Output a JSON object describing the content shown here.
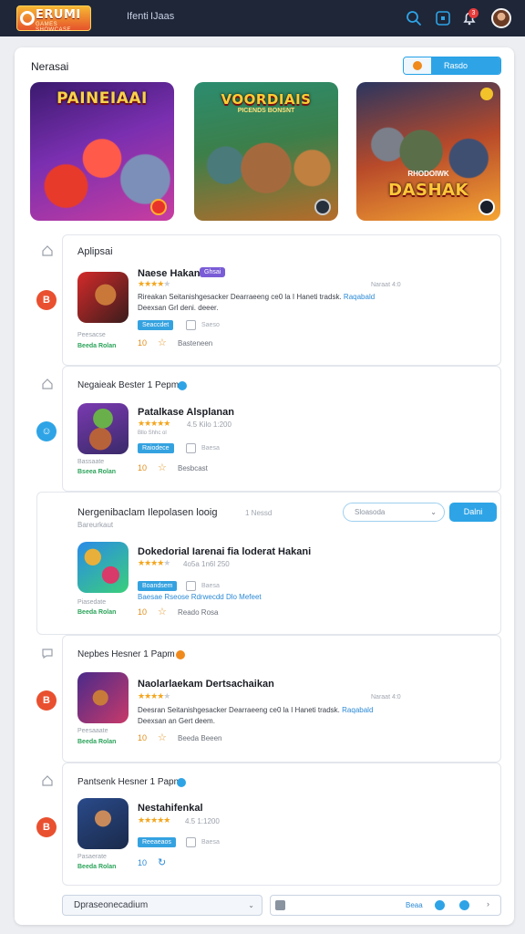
{
  "header": {
    "logo_title": "ERUMI",
    "logo_sub": "GAMES SHOWCASE",
    "nav": [
      "Ifenti",
      "IJaas"
    ],
    "bell_count": "3"
  },
  "section": {
    "title": "Nerasai",
    "pill_label": "Rasdo"
  },
  "banners": [
    {
      "title": "PAINEIAAI",
      "sub": ""
    },
    {
      "title": "VOORDIAIS",
      "sub": "PICENDS BONSNT"
    },
    {
      "title": "DASHAK",
      "sub": "RHODOIWK"
    }
  ],
  "items": [
    {
      "head": "Aplipsai",
      "name": "Naese Hakan",
      "tag": "Ghsai",
      "stars": "★★★★",
      "stars_dim": "★",
      "rating": "",
      "right_note": "Naraat 4:0",
      "desc_line1": "Rireakan Seitanishgesacker Dearraeeng ce0 la I Haneti tradsk.",
      "desc_link": "Raqabald",
      "desc_line2": "Deexsan Grl deni. deeer.",
      "chip": "Seaccdet",
      "small_txt": "Saeso",
      "under_a": "Peesacse",
      "under_b": "Beeda Rolan",
      "count": "10",
      "action": "Basteneen"
    },
    {
      "head": "Negaieak Bester  1 Pepm",
      "name": "Patalkase Alsplanan",
      "tag": "",
      "stars": "★★★★★",
      "stars_dim": "",
      "rating": "4.5 Kilo 1:200",
      "sub_rating": "Bllo Shhc ol",
      "right_note": "",
      "desc_line1": "",
      "desc_link": "",
      "desc_line2": "",
      "chip": "Raiodece",
      "small_txt": "Baesa",
      "under_a": "Bassaate",
      "under_b": "Bseea Rolan",
      "count": "10",
      "action": "Besbcast"
    },
    {
      "head": "Nergenibaclam Ilepolasen looig",
      "head_note": "1 Nessd",
      "sub_head": "Bareurkaut",
      "select_label": "Sloasoda",
      "button_label": "Dalni",
      "name": "Dokedorial Iarenai fia loderat Hakani",
      "tag": "",
      "stars": "★★★★",
      "stars_dim": "★",
      "rating": "4o5a 1n6l 250",
      "right_note": "",
      "desc_line1": "",
      "desc_link": "Baesae Rseose Rdrwecdd Dlo Mefeet",
      "desc_line2": "",
      "chip": "Boandsem",
      "small_txt": "Baesa",
      "under_a": "Piasedate",
      "under_b": "Beeda Rolan",
      "count": "10",
      "action": "Reado Rosa"
    },
    {
      "head": "Nepbes Hesner  1 Papm",
      "name": "Naolarlaekam Dertsachaikan",
      "tag": "",
      "stars": "★★★★",
      "stars_dim": "★",
      "rating": "",
      "right_note": "Naraat 4:0",
      "desc_line1": "Deesran Seitanishgesacker Dearraeeng ce0 la I Haneti tradsk.",
      "desc_link": "Raqabald",
      "desc_line2": "Deexsan an Gert deem.",
      "chip": "",
      "small_txt": "",
      "under_a": "Peesaaate",
      "under_b": "Beeda Rolan",
      "count": "10",
      "action": "Beeda Beeen"
    },
    {
      "head": "Pantsenk Hesner  1 Papm",
      "name": "Nestahifenkal",
      "tag": "",
      "stars": "★★★★★",
      "stars_dim": "",
      "rating": "4.5  1:1200",
      "right_note": "",
      "desc_line1": "",
      "desc_link": "",
      "desc_line2": "",
      "chip": "Reeaeaos",
      "small_txt": "Baesa",
      "under_a": "Pasaerate",
      "under_b": "Beeda Rolan",
      "count": "10",
      "action": ""
    }
  ],
  "footer": {
    "select_label": "Dpraseonecadium",
    "bar_text": "Beaa",
    "next": "›"
  },
  "colors": {
    "topbar": "#1e2638",
    "accent_blue": "#2ea4e6",
    "accent_orange": "#f08a1c",
    "star": "#f3a51d",
    "red_action": "#e9502f"
  }
}
